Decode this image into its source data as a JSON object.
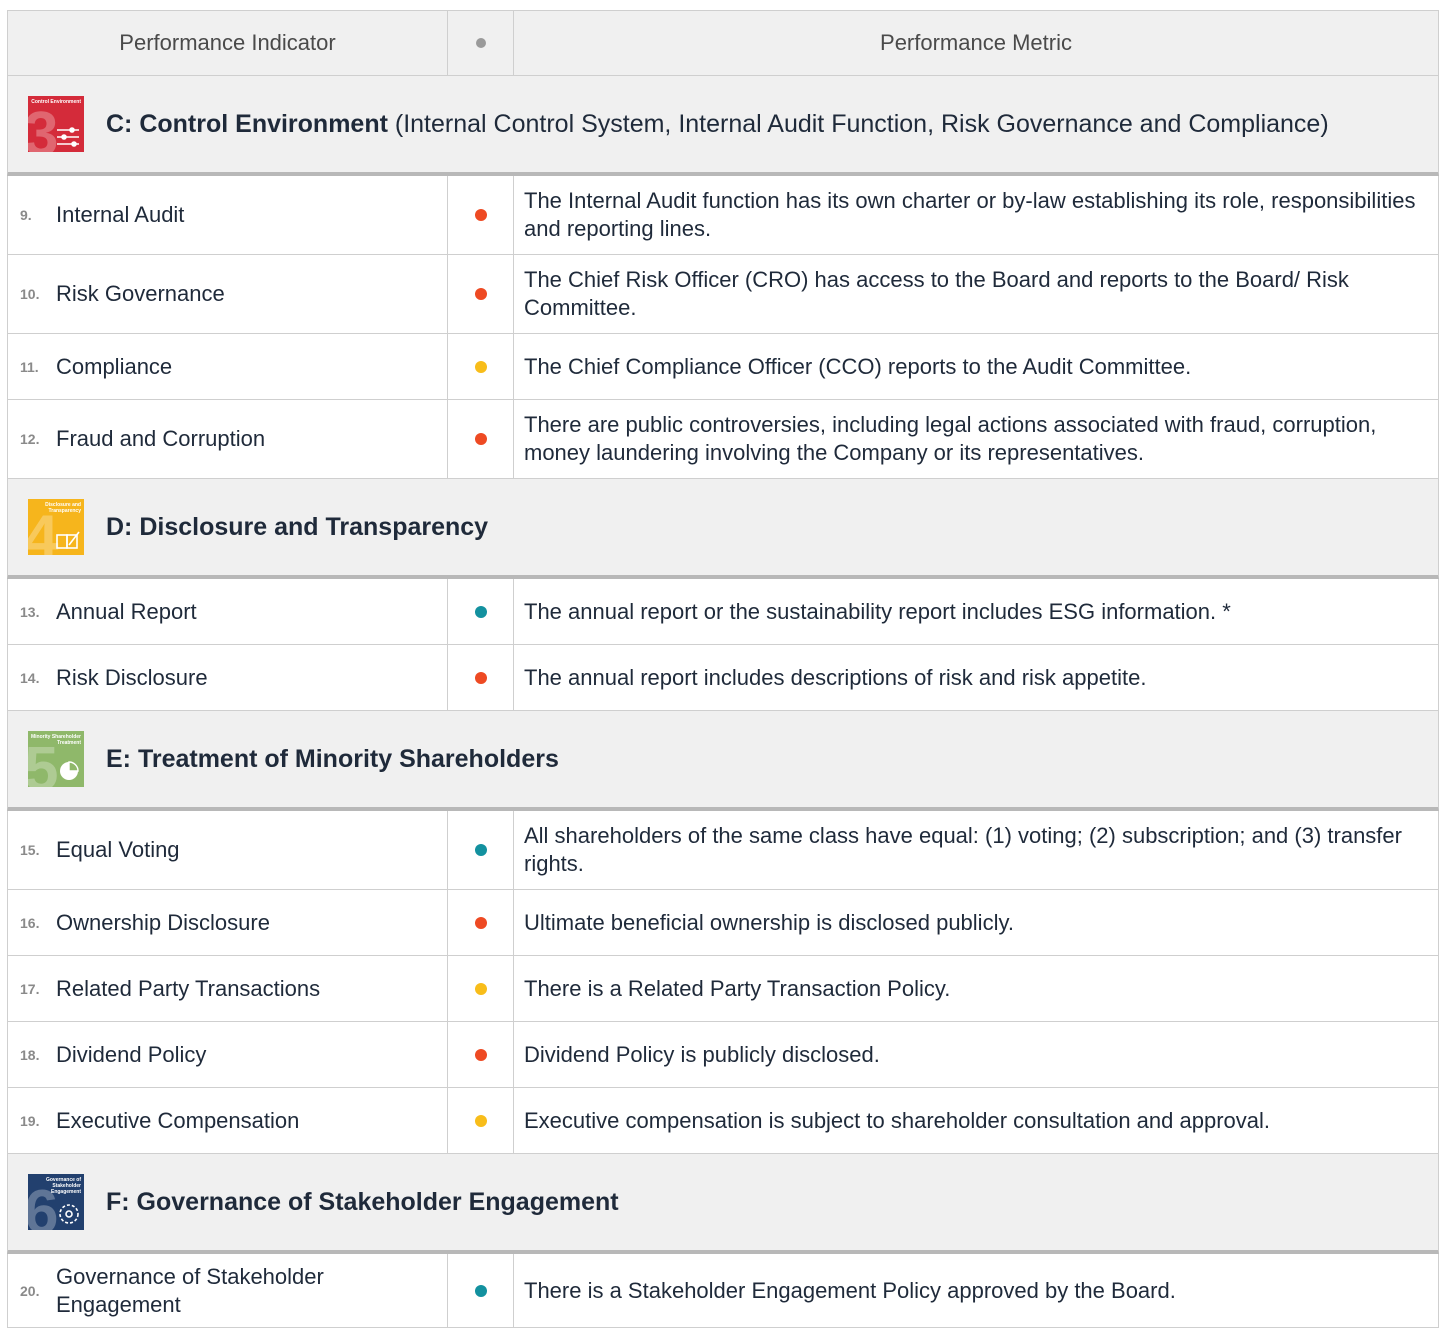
{
  "header": {
    "indicator_label": "Performance Indicator",
    "metric_label": "Performance Metric",
    "dot_color": "#9a9a9a"
  },
  "colors": {
    "red": "#ee4a23",
    "yellow": "#f8bd1a",
    "teal": "#13919f"
  },
  "sections": [
    {
      "title": "C: Control Environment",
      "description": " (Internal Control System, Internal Audit Function, Risk Governance and Compliance)",
      "badge": {
        "number": "3",
        "text": "Control Environment",
        "color": "#d42b3a",
        "icon": "sliders-icon"
      },
      "rows": [
        {
          "num": "9.",
          "indicator": "Internal Audit",
          "status": "red",
          "metric": "The Internal Audit function has its own charter or by-law establishing its role, responsibilities and reporting lines."
        },
        {
          "num": "10.",
          "indicator": "Risk Governance",
          "status": "red",
          "metric": "The Chief Risk Officer (CRO) has access to the Board and reports to the Board/ Risk Committee."
        },
        {
          "num": "11.",
          "indicator": "Compliance",
          "status": "yellow",
          "metric": "The Chief Compliance Officer (CCO) reports to the Audit Committee."
        },
        {
          "num": "12.",
          "indicator": "Fraud and Corruption",
          "status": "red",
          "metric": "There are public controversies, including legal actions associated with fraud, corruption, money laundering involving the Company or its representatives."
        }
      ]
    },
    {
      "title": "D: Disclosure and Transparency",
      "description": "",
      "badge": {
        "number": "4",
        "text": "Disclosure and Transparency",
        "color": "#f6b51c",
        "icon": "report-icon"
      },
      "rows": [
        {
          "num": "13.",
          "indicator": "Annual Report",
          "status": "teal",
          "metric": "The annual report or the sustainability report includes ESG information. *"
        },
        {
          "num": "14.",
          "indicator": "Risk Disclosure",
          "status": "red",
          "metric": "The annual report includes descriptions of risk and risk appetite."
        }
      ]
    },
    {
      "title": "E: Treatment of Minority Shareholders",
      "description": "",
      "badge": {
        "number": "5",
        "text": "Minority Shareholder Treatment",
        "color": "#8fb86a",
        "icon": "pie-chart-icon"
      },
      "rows": [
        {
          "num": "15.",
          "indicator": "Equal Voting",
          "status": "teal",
          "metric": "All shareholders of the same class have equal: (1) voting; (2) subscription; and (3) transfer rights."
        },
        {
          "num": "16.",
          "indicator": "Ownership Disclosure",
          "status": "red",
          "metric": "Ultimate beneficial ownership is disclosed publicly."
        },
        {
          "num": "17.",
          "indicator": "Related Party Transactions",
          "status": "yellow",
          "metric": "There is a Related Party Transaction Policy."
        },
        {
          "num": "18.",
          "indicator": "Dividend Policy",
          "status": "red",
          "metric": "Dividend Policy is publicly disclosed."
        },
        {
          "num": "19.",
          "indicator": "Executive Compensation",
          "status": "yellow",
          "metric": "Executive compensation is subject to shareholder consultation and approval."
        }
      ]
    },
    {
      "title": "F: Governance of Stakeholder Engagement",
      "description": "",
      "badge": {
        "number": "6",
        "text": "Governance of Stakeholder Engagement",
        "color": "#22406e",
        "icon": "network-icon"
      },
      "rows": [
        {
          "num": "20.",
          "indicator": "Governance of Stakeholder Engagement",
          "status": "teal",
          "metric": "There is a Stakeholder Engagement Policy approved by the Board."
        }
      ]
    }
  ]
}
